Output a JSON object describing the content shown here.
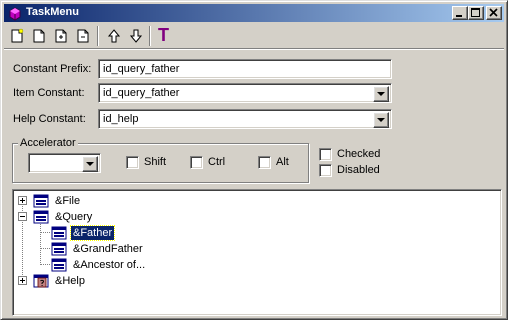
{
  "window": {
    "title": "TaskMenu",
    "controls": [
      "minimize-icon",
      "maximize-icon",
      "close-icon"
    ]
  },
  "toolbar": {
    "buttons": [
      {
        "name": "new-item-icon"
      },
      {
        "name": "new-page-icon"
      },
      {
        "name": "insert-page-icon"
      },
      {
        "name": "delete-page-icon"
      },
      {
        "name": "move-up-icon"
      },
      {
        "name": "move-down-icon"
      },
      {
        "name": "text-tool-icon",
        "glyph": "T",
        "color": "#800080"
      }
    ]
  },
  "form": {
    "constant_prefix_label": "Constant Prefix:",
    "constant_prefix_value": "id_query_father",
    "item_constant_label": "Item Constant:",
    "item_constant_value": "id_query_father",
    "help_constant_label": "Help Constant:",
    "help_constant_value": "id_help"
  },
  "accelerator": {
    "title": "Accelerator",
    "key_value": "",
    "shift": "Shift",
    "ctrl": "Ctrl",
    "alt": "Alt"
  },
  "options": {
    "checked": "Checked",
    "disabled": "Disabled"
  },
  "tree": {
    "items": [
      {
        "label": "&File",
        "expanded": false,
        "level": 0,
        "icon": "menu-icon"
      },
      {
        "label": "&Query",
        "expanded": true,
        "level": 0,
        "icon": "menu-icon"
      },
      {
        "label": "&Father",
        "level": 1,
        "selected": true,
        "icon": "menu-item-icon"
      },
      {
        "label": "&GrandFather",
        "level": 1,
        "icon": "menu-item-icon"
      },
      {
        "label": "&Ancestor of...",
        "level": 1,
        "icon": "menu-item-icon"
      },
      {
        "label": "&Help",
        "expanded": false,
        "level": 0,
        "icon": "help-menu-icon"
      }
    ]
  },
  "colors": {
    "title_start": "#0a246a",
    "title_end": "#a6caf0",
    "face": "#d4d0c8",
    "selection": "#0a246a"
  }
}
